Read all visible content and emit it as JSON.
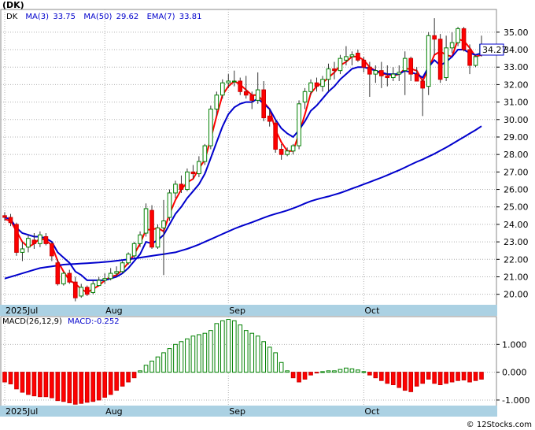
{
  "chart_data": [
    {
      "type": "candlestick",
      "title": "(DK)",
      "legend": [
        {
          "label": "DK",
          "value": "",
          "color": "#000000"
        },
        {
          "label": "MA(3)",
          "value": "33.75",
          "color": "#ff0000"
        },
        {
          "label": "MA(50)",
          "value": "29.62",
          "color": "#0000cc"
        },
        {
          "label": "EMA(7)",
          "value": "33.81",
          "color": "#0000cc"
        }
      ],
      "last_price": "34.27",
      "watermark": "© 12Stocks.com",
      "ylim": [
        19.4,
        36.3
      ],
      "yticks": [
        "20.00",
        "21.00",
        "22.00",
        "23.00",
        "24.00",
        "25.00",
        "26.00",
        "27.00",
        "28.00",
        "29.00",
        "30.00",
        "31.00",
        "32.00",
        "33.00",
        "34.00",
        "35.00"
      ],
      "month_labels": [
        {
          "label": "2025Jul",
          "index": 0
        },
        {
          "label": "Aug",
          "index": 17
        },
        {
          "label": "Sep",
          "index": 38
        },
        {
          "label": "Oct",
          "index": 61
        }
      ],
      "candles": [
        [
          24.5,
          24.7,
          24.2,
          24.4
        ],
        [
          24.4,
          24.6,
          23.9,
          24.1
        ],
        [
          24.0,
          24.1,
          22.2,
          22.4
        ],
        [
          22.4,
          23.0,
          21.9,
          22.6
        ],
        [
          22.7,
          23.4,
          22.4,
          23.2
        ],
        [
          23.1,
          23.5,
          22.6,
          22.9
        ],
        [
          22.9,
          23.6,
          22.7,
          23.4
        ],
        [
          23.3,
          23.5,
          22.8,
          22.9
        ],
        [
          22.9,
          23.0,
          21.9,
          22.2
        ],
        [
          21.8,
          22.0,
          20.5,
          20.6
        ],
        [
          20.6,
          21.3,
          20.5,
          21.2
        ],
        [
          21.2,
          21.4,
          20.6,
          20.7
        ],
        [
          20.7,
          21.0,
          19.6,
          19.8
        ],
        [
          19.9,
          20.6,
          19.8,
          20.4
        ],
        [
          20.4,
          20.5,
          19.9,
          20.0
        ],
        [
          20.1,
          20.8,
          20.0,
          20.6
        ],
        [
          20.5,
          21.0,
          20.5,
          20.8
        ],
        [
          20.8,
          21.2,
          20.6,
          20.9
        ],
        [
          20.9,
          21.5,
          20.8,
          21.2
        ],
        [
          21.2,
          21.6,
          21.0,
          21.3
        ],
        [
          21.3,
          21.9,
          21.2,
          21.8
        ],
        [
          21.8,
          22.4,
          21.7,
          22.3
        ],
        [
          22.2,
          23.0,
          22.1,
          22.9
        ],
        [
          22.9,
          23.6,
          22.7,
          23.4
        ],
        [
          23.5,
          25.2,
          23.3,
          24.9
        ],
        [
          24.8,
          25.1,
          22.6,
          22.7
        ],
        [
          22.7,
          24.0,
          22.6,
          23.8
        ],
        [
          23.8,
          25.4,
          21.1,
          24.2
        ],
        [
          24.4,
          26.0,
          24.2,
          25.8
        ],
        [
          25.8,
          26.5,
          25.5,
          26.3
        ],
        [
          26.3,
          26.8,
          25.8,
          26.0
        ],
        [
          26.0,
          27.2,
          25.9,
          27.0
        ],
        [
          27.0,
          27.4,
          26.6,
          26.9
        ],
        [
          26.9,
          27.9,
          26.7,
          27.6
        ],
        [
          27.6,
          28.6,
          27.4,
          28.5
        ],
        [
          28.5,
          30.8,
          28.3,
          30.6
        ],
        [
          30.6,
          31.6,
          30.2,
          31.4
        ],
        [
          31.4,
          32.3,
          31.2,
          32.1
        ],
        [
          32.1,
          32.6,
          31.8,
          32.2
        ],
        [
          32.2,
          32.8,
          31.9,
          32.2
        ],
        [
          32.2,
          32.4,
          31.4,
          31.6
        ],
        [
          31.6,
          32.5,
          31.2,
          31.4
        ],
        [
          31.4,
          31.6,
          30.6,
          31.1
        ],
        [
          31.1,
          32.7,
          30.9,
          31.7
        ],
        [
          31.7,
          32.2,
          29.9,
          30.1
        ],
        [
          30.2,
          30.6,
          29.6,
          29.9
        ],
        [
          29.8,
          30.0,
          28.1,
          28.3
        ],
        [
          28.3,
          28.6,
          27.7,
          28.0
        ],
        [
          28.0,
          28.4,
          27.9,
          28.2
        ],
        [
          28.2,
          28.6,
          28.0,
          28.5
        ],
        [
          28.5,
          31.1,
          28.3,
          30.9
        ],
        [
          31.0,
          31.8,
          30.6,
          31.6
        ],
        [
          31.6,
          32.3,
          31.4,
          32.1
        ],
        [
          32.1,
          32.4,
          31.6,
          31.9
        ],
        [
          31.9,
          32.5,
          31.6,
          32.3
        ],
        [
          32.3,
          33.2,
          31.6,
          32.9
        ],
        [
          32.9,
          33.3,
          32.3,
          32.8
        ],
        [
          32.8,
          33.7,
          32.6,
          33.5
        ],
        [
          33.4,
          34.2,
          33.1,
          33.6
        ],
        [
          33.6,
          33.9,
          33.1,
          33.7
        ],
        [
          33.8,
          34.0,
          33.3,
          33.4
        ],
        [
          33.4,
          33.6,
          32.7,
          33.0
        ],
        [
          33.0,
          33.3,
          31.3,
          32.6
        ],
        [
          32.6,
          33.1,
          32.1,
          32.8
        ],
        [
          32.8,
          33.3,
          31.8,
          32.5
        ],
        [
          32.5,
          33.1,
          31.9,
          32.4
        ],
        [
          32.4,
          33.0,
          32.2,
          32.6
        ],
        [
          32.6,
          33.1,
          32.2,
          32.7
        ],
        [
          32.8,
          33.9,
          31.4,
          33.5
        ],
        [
          33.5,
          33.6,
          32.2,
          32.6
        ],
        [
          32.6,
          33.0,
          32.2,
          32.2
        ],
        [
          32.2,
          32.3,
          30.2,
          31.8
        ],
        [
          31.9,
          35.0,
          31.4,
          34.8
        ],
        [
          34.8,
          35.8,
          33.7,
          34.6
        ],
        [
          34.6,
          34.9,
          32.1,
          32.3
        ],
        [
          32.4,
          34.8,
          32.2,
          34.1
        ],
        [
          34.1,
          35.0,
          33.8,
          34.4
        ],
        [
          34.4,
          35.3,
          34.2,
          35.2
        ],
        [
          35.2,
          35.3,
          33.9,
          34.0
        ],
        [
          34.0,
          34.3,
          32.6,
          33.1
        ],
        [
          33.1,
          33.7,
          33.0,
          33.6
        ],
        [
          33.7,
          34.8,
          33.6,
          34.3
        ]
      ],
      "series": [
        {
          "name": "MA(3)",
          "color": "#ff0000",
          "values": [
            24.3,
            24.2,
            23.6,
            23.0,
            22.7,
            22.9,
            23.2,
            23.1,
            22.8,
            21.9,
            21.3,
            20.8,
            20.6,
            20.3,
            20.1,
            20.3,
            20.5,
            20.8,
            21.0,
            21.1,
            21.4,
            21.8,
            22.3,
            22.9,
            23.7,
            23.7,
            23.8,
            23.6,
            24.6,
            25.4,
            26.0,
            26.4,
            26.6,
            27.2,
            27.7,
            28.9,
            30.2,
            31.4,
            31.9,
            32.2,
            32.0,
            31.7,
            31.4,
            31.4,
            31.0,
            30.6,
            29.4,
            28.7,
            28.2,
            28.2,
            29.2,
            30.3,
            31.5,
            31.9,
            32.1,
            32.4,
            32.7,
            33.1,
            33.3,
            33.6,
            33.6,
            33.4,
            33.0,
            32.8,
            32.6,
            32.6,
            32.5,
            32.6,
            32.9,
            32.9,
            32.8,
            32.2,
            32.9,
            33.7,
            33.9,
            33.7,
            33.6,
            34.6,
            34.5,
            34.1,
            33.6,
            33.7
          ]
        },
        {
          "name": "EMA(7)",
          "color": "#0000cc",
          "values": [
            24.4,
            24.3,
            23.8,
            23.5,
            23.4,
            23.3,
            23.3,
            23.2,
            23.0,
            22.4,
            22.1,
            21.8,
            21.3,
            21.1,
            20.8,
            20.8,
            20.8,
            20.8,
            20.9,
            21.0,
            21.2,
            21.5,
            21.9,
            22.3,
            23.0,
            22.9,
            23.1,
            23.4,
            24.0,
            24.6,
            25.0,
            25.5,
            25.9,
            26.3,
            26.9,
            27.8,
            28.7,
            29.6,
            30.3,
            30.7,
            30.9,
            31.0,
            31.0,
            31.2,
            30.9,
            30.6,
            30.0,
            29.5,
            29.2,
            29.0,
            29.4,
            29.9,
            30.5,
            30.8,
            31.2,
            31.6,
            31.9,
            32.3,
            32.6,
            32.9,
            33.0,
            33.0,
            32.9,
            32.8,
            32.7,
            32.6,
            32.6,
            32.6,
            32.8,
            32.7,
            32.6,
            32.4,
            33.0,
            33.4,
            33.1,
            33.3,
            33.6,
            34.0,
            34.0,
            33.8,
            33.7,
            33.8
          ]
        },
        {
          "name": "MA(50)",
          "color": "#0000cc",
          "values": [
            20.9,
            21.0,
            21.1,
            21.2,
            21.3,
            21.4,
            21.5,
            21.55,
            21.6,
            21.65,
            21.7,
            21.72,
            21.74,
            21.76,
            21.78,
            21.8,
            21.82,
            21.85,
            21.88,
            21.92,
            21.96,
            22.0,
            22.05,
            22.1,
            22.15,
            22.2,
            22.25,
            22.3,
            22.35,
            22.4,
            22.5,
            22.6,
            22.72,
            22.85,
            23.0,
            23.15,
            23.3,
            23.45,
            23.6,
            23.75,
            23.88,
            24.0,
            24.12,
            24.25,
            24.38,
            24.5,
            24.6,
            24.7,
            24.8,
            24.92,
            25.05,
            25.2,
            25.33,
            25.43,
            25.52,
            25.6,
            25.7,
            25.8,
            25.92,
            26.05,
            26.17,
            26.3,
            26.42,
            26.55,
            26.68,
            26.82,
            26.96,
            27.1,
            27.26,
            27.42,
            27.58,
            27.72,
            27.88,
            28.04,
            28.22,
            28.4,
            28.6,
            28.8,
            29.0,
            29.2,
            29.4,
            29.62
          ]
        }
      ]
    },
    {
      "type": "bar",
      "title": "MACD(26,12,9)",
      "subtitle": "MACD:-0.252",
      "ylim": [
        -1.2,
        2.0
      ],
      "yticks": [
        "-1.000",
        "0.000",
        "1.000"
      ],
      "month_labels": [
        {
          "label": "2025Jul",
          "index": 0
        },
        {
          "label": "Aug",
          "index": 17
        },
        {
          "label": "Sep",
          "index": 38
        },
        {
          "label": "Oct",
          "index": 61
        }
      ],
      "values": [
        -0.35,
        -0.42,
        -0.6,
        -0.72,
        -0.8,
        -0.85,
        -0.88,
        -0.88,
        -0.92,
        -1.02,
        -1.05,
        -1.1,
        -1.15,
        -1.12,
        -1.08,
        -1.05,
        -1.0,
        -0.9,
        -0.8,
        -0.65,
        -0.5,
        -0.35,
        -0.2,
        0.05,
        0.25,
        0.4,
        0.55,
        0.7,
        0.85,
        1.0,
        1.1,
        1.2,
        1.3,
        1.35,
        1.4,
        1.5,
        1.75,
        1.85,
        1.9,
        1.85,
        1.7,
        1.5,
        1.4,
        1.3,
        1.1,
        0.9,
        0.7,
        0.35,
        0.05,
        -0.2,
        -0.35,
        -0.25,
        -0.1,
        -0.02,
        0.02,
        0.05,
        0.05,
        0.1,
        0.15,
        0.12,
        0.08,
        0.02,
        -0.1,
        -0.2,
        -0.3,
        -0.4,
        -0.45,
        -0.55,
        -0.65,
        -0.7,
        -0.5,
        -0.4,
        -0.25,
        -0.4,
        -0.45,
        -0.4,
        -0.35,
        -0.3,
        -0.28,
        -0.35,
        -0.3,
        -0.25
      ]
    }
  ]
}
